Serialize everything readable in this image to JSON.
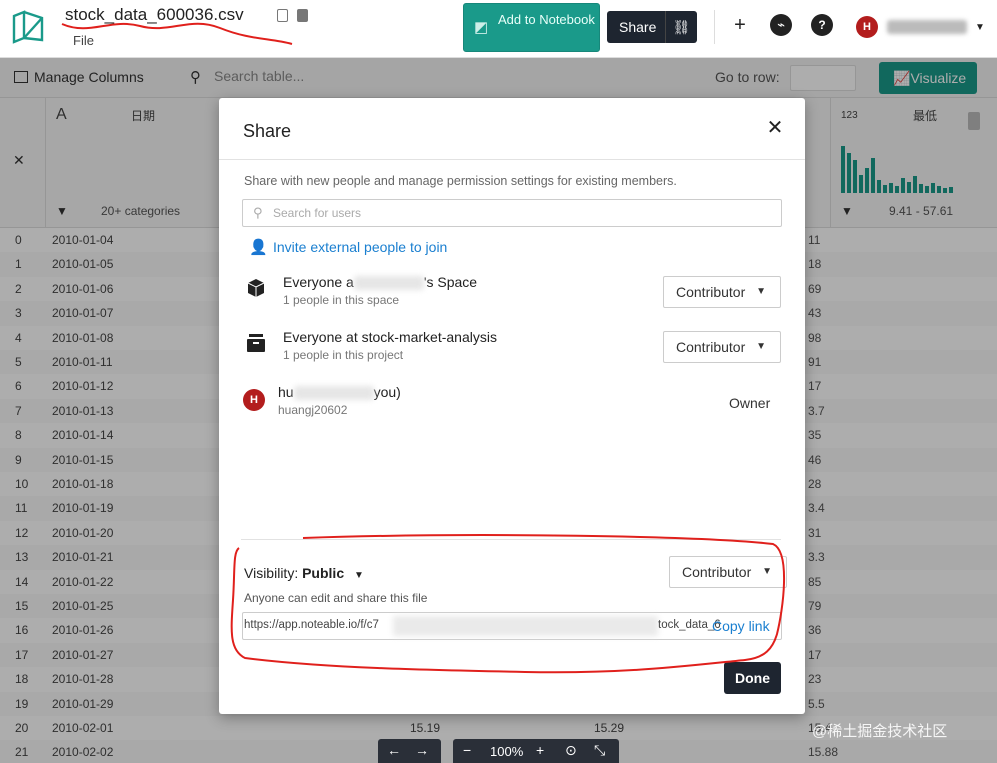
{
  "app": {
    "file_name": "stock_data_600036.csv",
    "file_menu": "File",
    "add_to_notebook": "Add to Notebook",
    "share_button": "Share",
    "avatar_initial": "H",
    "brand_color": "#1a9a8a"
  },
  "toolbar": {
    "manage_columns": "Manage Columns",
    "search_placeholder": "Search table...",
    "go_to_row": "Go to row:",
    "visualize": "Visualize"
  },
  "table": {
    "columns": [
      {
        "type_icon": "A",
        "name": "日期",
        "filter_text": "20+ categories"
      },
      {
        "type_icon": "123",
        "name": "最低",
        "stats_text": "9.41 - 57.61"
      }
    ],
    "rows": [
      {
        "idx": "0",
        "date": "2010-01-04",
        "edge": "11"
      },
      {
        "idx": "1",
        "date": "2010-01-05",
        "edge": "18"
      },
      {
        "idx": "2",
        "date": "2010-01-06",
        "edge": "69"
      },
      {
        "idx": "3",
        "date": "2010-01-07",
        "edge": "43"
      },
      {
        "idx": "4",
        "date": "2010-01-08",
        "edge": "98"
      },
      {
        "idx": "5",
        "date": "2010-01-11",
        "edge": "91"
      },
      {
        "idx": "6",
        "date": "2010-01-12",
        "edge": "17"
      },
      {
        "idx": "7",
        "date": "2010-01-13",
        "edge": "3.7"
      },
      {
        "idx": "8",
        "date": "2010-01-14",
        "edge": "35"
      },
      {
        "idx": "9",
        "date": "2010-01-15",
        "edge": "46"
      },
      {
        "idx": "10",
        "date": "2010-01-18",
        "edge": "28"
      },
      {
        "idx": "11",
        "date": "2010-01-19",
        "edge": "3.4"
      },
      {
        "idx": "12",
        "date": "2010-01-20",
        "edge": "31"
      },
      {
        "idx": "13",
        "date": "2010-01-21",
        "edge": "3.3"
      },
      {
        "idx": "14",
        "date": "2010-01-22",
        "edge": "85"
      },
      {
        "idx": "15",
        "date": "2010-01-25",
        "edge": "79"
      },
      {
        "idx": "16",
        "date": "2010-01-26",
        "edge": "36"
      },
      {
        "idx": "17",
        "date": "2010-01-27",
        "edge": "17"
      },
      {
        "idx": "18",
        "date": "2010-01-28",
        "edge": "23"
      },
      {
        "idx": "19",
        "date": "2010-01-29",
        "edge": "5.5"
      },
      {
        "idx": "20",
        "date": "2010-02-01",
        "v1": "15.19",
        "v2": "15.29",
        "edge": "15.4"
      },
      {
        "idx": "21",
        "date": "2010-02-02",
        "v1": "",
        "v2": "",
        "edge": "15.88"
      }
    ]
  },
  "zoom": {
    "level": "100%"
  },
  "modal": {
    "title": "Share",
    "description": "Share with new people and manage permission settings for existing members.",
    "search_placeholder": "Search for users",
    "invite_link": "Invite external people to join",
    "members": [
      {
        "name_start": "Everyone a",
        "name_end": "'s Space",
        "subtitle": "1 people in this space",
        "role": "Contributor",
        "icon": "cube-icon"
      },
      {
        "name": "Everyone at stock-market-analysis",
        "subtitle": "1 people in this project",
        "role": "Contributor",
        "icon": "archive-box-icon"
      },
      {
        "name_start": "hu",
        "name_end": "you)",
        "subtitle": "huangj20602",
        "role": "Owner",
        "icon": "avatar",
        "avatar_initial": "H"
      }
    ],
    "visibility_label": "Visibility:",
    "visibility_value": "Public",
    "visibility_role": "Contributor",
    "visibility_desc": "Anyone can edit and share this file",
    "link_start": "https://app.noteable.io/f/c7",
    "link_end": "tock_data_6",
    "copy_link": "Copy link",
    "done": "Done"
  },
  "watermark": "@稀土掘金技术社区"
}
